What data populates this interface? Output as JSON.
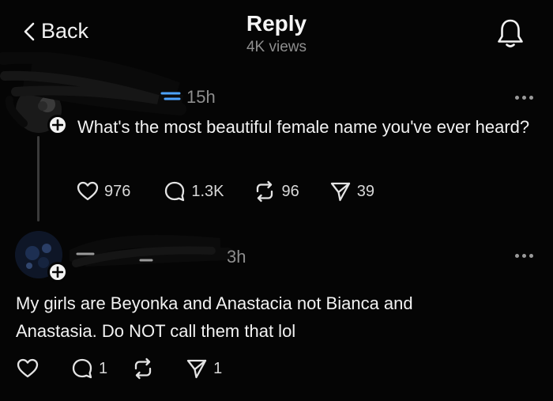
{
  "header": {
    "back_label": "Back",
    "title": "Reply",
    "subtitle": "4K views"
  },
  "posts": [
    {
      "time": "15h",
      "text": "What's the most beautiful female name you've ever heard?",
      "likes": "976",
      "replies": "1.3K",
      "reposts": "96",
      "shares": "39"
    },
    {
      "time": "3h",
      "text": "My girls are Beyonka and Anastacia not Bianca and Anastasia. Do NOT call them that lol",
      "likes": "",
      "replies": "1",
      "reposts": "",
      "shares": "1"
    }
  ],
  "icons": {
    "back": "chevron-left-icon",
    "notifications": "bell-icon",
    "more": "ellipsis-icon",
    "like": "heart-icon",
    "reply": "speech-bubble-icon",
    "repost": "repost-icon",
    "share": "send-icon",
    "follow": "plus-icon"
  },
  "colors": {
    "background": "#050505",
    "text": "#f2f2f2",
    "muted": "#8e8e8e",
    "thread_line": "#3b3b3b"
  }
}
